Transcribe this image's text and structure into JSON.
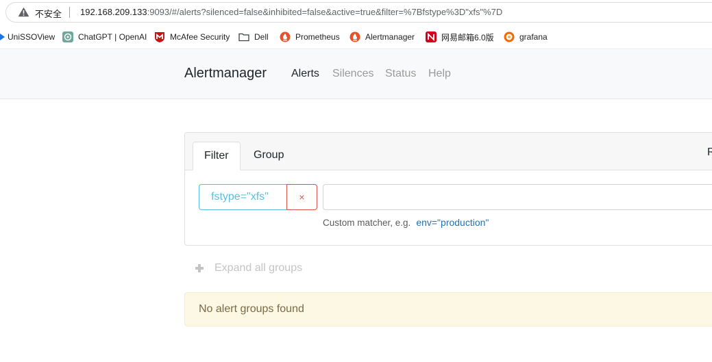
{
  "browser": {
    "security_label": "不安全",
    "url_host": "192.168.209.133",
    "url_rest": ":9093/#/alerts?silenced=false&inhibited=false&active=true&filter=%7Bfstype%3D\"xfs\"%7D"
  },
  "bookmarks": [
    {
      "label": "UniSSOView",
      "icon": "uni-sso-icon"
    },
    {
      "label": "ChatGPT | OpenAI",
      "icon": "openai-icon"
    },
    {
      "label": "McAfee Security",
      "icon": "mcafee-icon"
    },
    {
      "label": "Dell",
      "icon": "folder-icon"
    },
    {
      "label": "Prometheus",
      "icon": "prometheus-icon"
    },
    {
      "label": "Alertmanager",
      "icon": "alertmanager-icon"
    },
    {
      "label": "网易邮箱6.0版",
      "icon": "netease-mail-icon"
    },
    {
      "label": "grafana",
      "icon": "grafana-icon"
    }
  ],
  "navbar": {
    "brand": "Alertmanager",
    "links": [
      {
        "label": "Alerts",
        "active": true
      },
      {
        "label": "Silences",
        "active": false
      },
      {
        "label": "Status",
        "active": false
      },
      {
        "label": "Help",
        "active": false
      }
    ]
  },
  "filter_card": {
    "tabs": [
      {
        "label": "Filter",
        "active": true
      },
      {
        "label": "Group",
        "active": false
      }
    ],
    "header_right": "R",
    "matcher": "fstype=\"xfs\"",
    "remove_symbol": "×",
    "input_value": "",
    "help_text": "Custom matcher, e.g.",
    "help_example": "env=\"production\""
  },
  "expand_all_label": "Expand all groups",
  "alert_message": "No alert groups found",
  "colors": {
    "matcher_accent": "#5bc0de",
    "remove_accent": "#d9534f",
    "alert_bg": "#fcf8e3",
    "example_link": "#1f6fb4"
  }
}
